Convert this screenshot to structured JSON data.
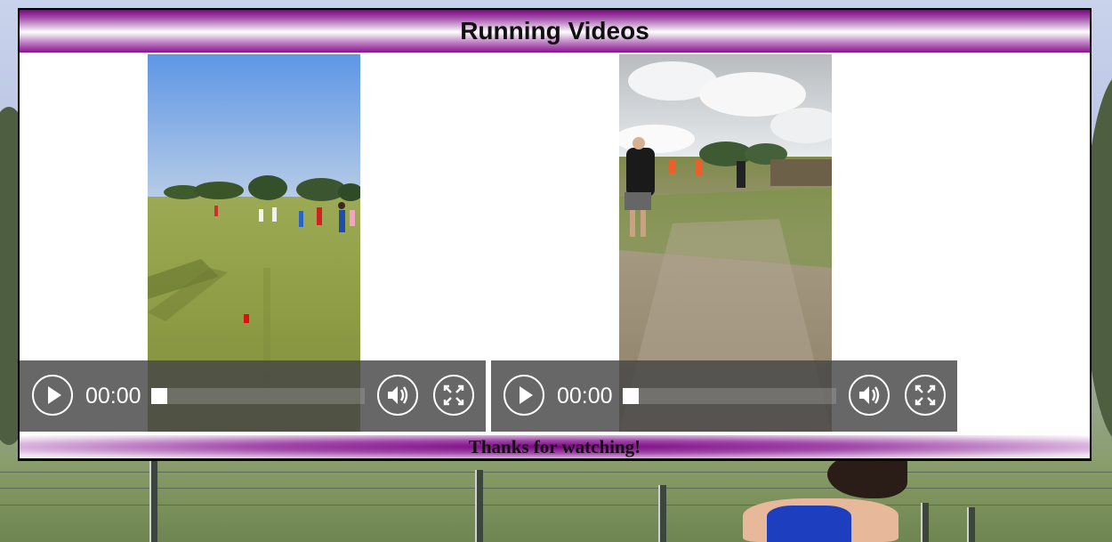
{
  "header": {
    "title": "Running Videos"
  },
  "players": [
    {
      "time": "00:00",
      "progress": 0,
      "icons": {
        "play": "play-icon",
        "volume": "volume-icon",
        "fullscreen": "fullscreen-icon"
      }
    },
    {
      "time": "00:00",
      "progress": 0,
      "icons": {
        "play": "play-icon",
        "volume": "volume-icon",
        "fullscreen": "fullscreen-icon"
      }
    }
  ],
  "footer": {
    "text": "Thanks for watching!"
  },
  "colors": {
    "accent": "#8a0e90",
    "controls_bg": "#464646"
  }
}
